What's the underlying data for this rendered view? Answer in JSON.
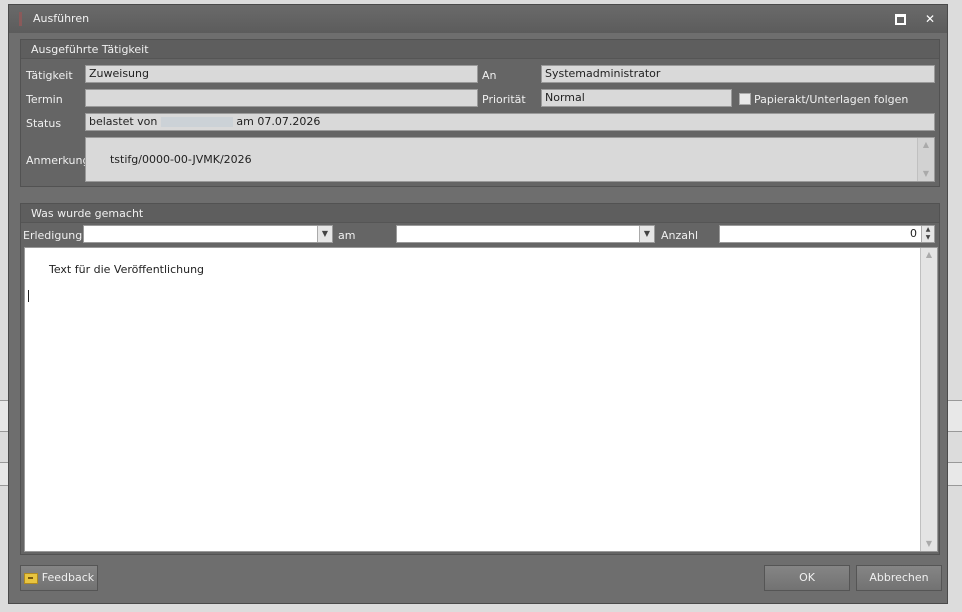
{
  "window": {
    "title": "Ausführen",
    "maximize_glyph": "□",
    "close_glyph": "✕"
  },
  "task_group": {
    "title": "Ausgeführte Tätigkeit",
    "taetigkeit_label": "Tätigkeit",
    "taetigkeit_value": "Zuweisung",
    "an_label": "An",
    "an_value": "Systemadministrator",
    "termin_label": "Termin",
    "termin_value": "",
    "prioritaet_label": "Priorität",
    "prioritaet_value": "Normal",
    "papierakt_label": "Papierakt/Unterlagen folgen",
    "status_label": "Status",
    "status_prefix": "belastet von",
    "status_suffix": "am 07.07.2026",
    "anmerkung_label": "Anmerkung",
    "anmerkung_value": "tstifg/0000-00-JVMK/2026"
  },
  "done_group": {
    "title": "Was wurde gemacht",
    "erledigung_label": "Erledigung",
    "erledigung_value": "",
    "am_label": "am",
    "am_value": "",
    "anzahl_label": "Anzahl",
    "anzahl_value": "0",
    "text_value": "Text für die Veröffentlichung"
  },
  "buttons": {
    "feedback": "Feedback",
    "ok": "OK",
    "cancel": "Abbrechen"
  },
  "icons": {
    "feedback": "feedback-icon",
    "dropdown": "chevron-down-icon"
  }
}
